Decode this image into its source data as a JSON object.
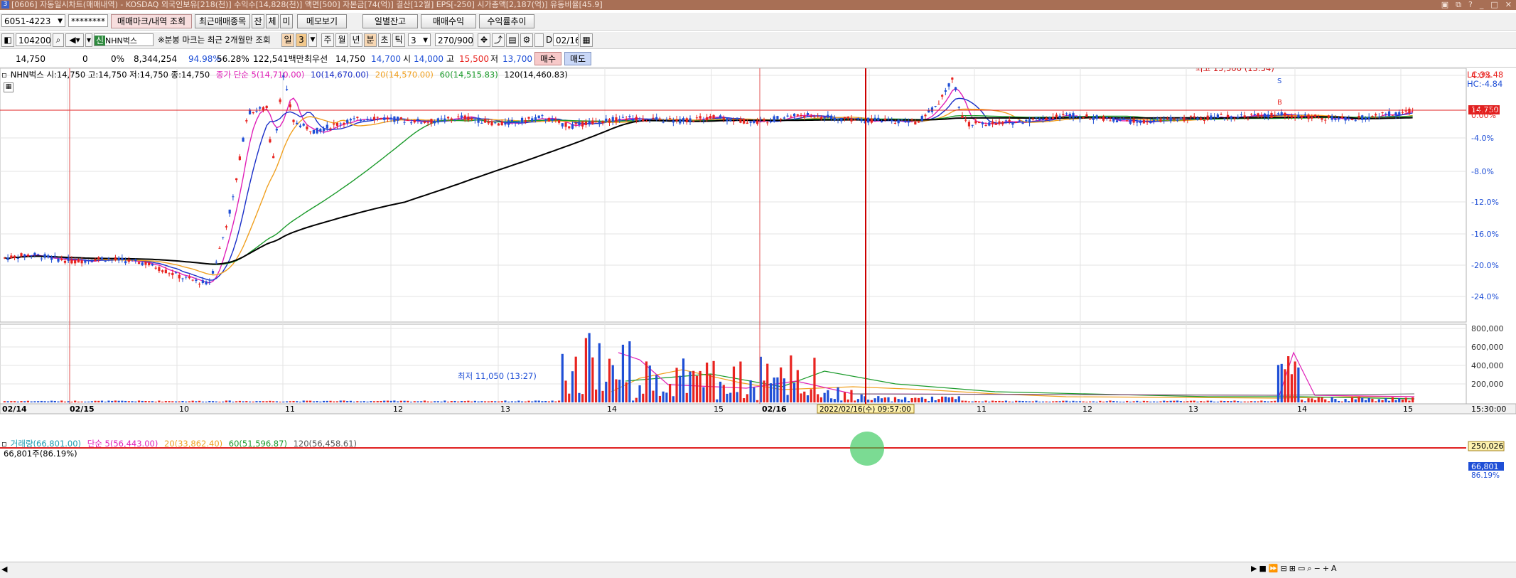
{
  "window": {
    "title": "[0606] 자동일시차트(매매내역) - KOSDAQ 외국인보유[218(천)] 수익수[14,828(천)] 액면[500] 자본금[74(억)] 결산[12월] EPS[-250] 시가총액[2,187(억)] 유동비율[45.9]",
    "app_icon": "3"
  },
  "toolbar1": {
    "account": "6051-4223",
    "password": "********",
    "btn_trade_history": "매매마크/내역 조회",
    "btn_recent": "최근매매종목",
    "btn_jan": "잔",
    "btn_che": "체",
    "btn_mi": "미",
    "btn_memo": "메모보기",
    "btn_daily_balance": "일별잔고",
    "btn_trade_profit": "매매수익",
    "btn_return_trend": "수익률추이"
  },
  "toolbar2": {
    "code": "104200",
    "badge": "신",
    "stock_name": "NHN벅스",
    "notice": "※분봉 마크는 최근 2개월만 조회",
    "period_day": "일",
    "period_num": "3",
    "period_week": "주",
    "period_month": "월",
    "period_year": "년",
    "period_min": "분",
    "period_sec": "초",
    "period_tick": "틱",
    "interval": "3",
    "range": "270/900",
    "date_check": "D",
    "date": "02/16"
  },
  "quote": {
    "price": "14,750",
    "change": "0",
    "change_pct": "0%",
    "volume": "8,344,254",
    "pct1": "94.98%",
    "pct2": "56.28%",
    "amount": "122,541백만",
    "best_label": "최우선",
    "best_ask": "14,750",
    "best_bid": "14,700",
    "open_label": "시",
    "open": "14,000",
    "high_label": "고",
    "high": "15,500",
    "low_label": "저",
    "low": "13,700",
    "buy": "매수",
    "sell": "매도"
  },
  "price_legend": {
    "title": "NHN벅스 시:14,750 고:14,750 저:14,750 종:14,750",
    "ma_title": "종가 단순 5(14,710.00)",
    "ma10": "10(14,670.00)",
    "ma20": "20(14,570.00)",
    "ma60": "60(14,515.83)",
    "ma120": "120(14,460.83)",
    "lc": "LC:33.48",
    "hc": "HC:-4.84"
  },
  "annotations": {
    "high": "최고 15,500 (13:54)",
    "low": "최저 11,050 (13:27)",
    "mark_s": "S",
    "mark_b": "B",
    "current_price": "14,750",
    "current_pct": "0.00%"
  },
  "volume_legend": {
    "title": "거래량(66,801.00)",
    "ma_title": "단순 5(56,443.00)",
    "ma20": "20(33,862.40)",
    "ma60": "60(51,596.87)",
    "ma120": "120(56,458.61)",
    "sub": "66,801주(86.19%)",
    "ref_value": "250,026",
    "cur_value": "66,801",
    "cur_pct": "86.19%"
  },
  "x_labels": [
    {
      "text": "02/14",
      "bold": true
    },
    {
      "text": "02/15",
      "bold": true
    },
    {
      "text": "10"
    },
    {
      "text": "11"
    },
    {
      "text": "12"
    },
    {
      "text": "13"
    },
    {
      "text": "14"
    },
    {
      "text": "15"
    },
    {
      "text": "02/16",
      "bold": true
    },
    {
      "text": "10"
    },
    {
      "text": "11"
    },
    {
      "text": "12"
    },
    {
      "text": "13"
    },
    {
      "text": "14"
    },
    {
      "text": "15"
    }
  ],
  "cursor_label": "2022/02/16(수) 09:57:00",
  "time_label": "15:30:00",
  "chart_data": {
    "type": "candlestick",
    "price_axis_pct": [
      "4.0%",
      "0.00%",
      "-4.0%",
      "-8.0%",
      "-12.0%",
      "-16.0%",
      "-20.0%",
      "-24.0%"
    ],
    "volume_axis": [
      "800,000",
      "600,000",
      "400,000",
      "200,000"
    ],
    "reference_price": 14750,
    "high": 15500,
    "low": 11050,
    "colors": {
      "up": "#e8231f",
      "down": "#1f4fd6",
      "ma5": "#e020b8",
      "ma10": "#1a2fc8",
      "ma20": "#f0a020",
      "ma60": "#1a9a2a",
      "ma120": "#000000",
      "ref_line": "#e02020"
    }
  }
}
